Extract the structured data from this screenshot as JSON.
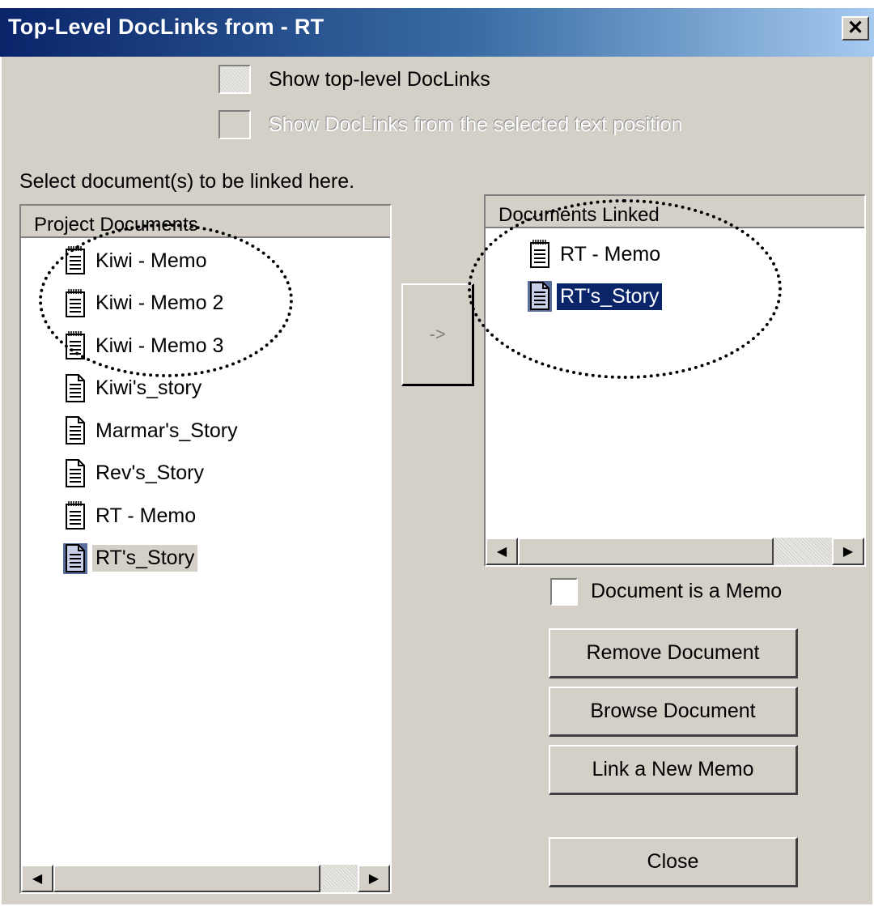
{
  "window": {
    "title": "Top-Level DocLinks from - RT",
    "close_glyph": "✕"
  },
  "options": {
    "show_top_level_label": "Show top-level DocLinks",
    "show_from_position_label": "Show DocLinks from the selected text position"
  },
  "instruction": "Select document(s) to be linked here.",
  "project_documents": {
    "header": "Project Documents",
    "items": [
      {
        "label": "Kiwi - Memo",
        "icon": "memo-icon"
      },
      {
        "label": "Kiwi - Memo 2",
        "icon": "memo-icon"
      },
      {
        "label": "Kiwi - Memo 3",
        "icon": "memo-icon"
      },
      {
        "label": "Kiwi's_story",
        "icon": "document-icon"
      },
      {
        "label": "Marmar's_Story",
        "icon": "document-icon"
      },
      {
        "label": "Rev's_Story",
        "icon": "document-icon"
      },
      {
        "label": "RT - Memo",
        "icon": "memo-icon"
      },
      {
        "label": "RT's_Story",
        "icon": "document-icon",
        "selected": true
      }
    ]
  },
  "add_button_label": "->",
  "documents_linked": {
    "header": "Documents Linked",
    "items": [
      {
        "label": "RT - Memo",
        "icon": "memo-icon"
      },
      {
        "label": "RT's_Story",
        "icon": "document-icon",
        "selected": true
      }
    ]
  },
  "memo_checkbox_label": "Document is a Memo",
  "buttons": {
    "remove": "Remove Document",
    "browse": "Browse Document",
    "link_memo": "Link a New Memo",
    "close": "Close"
  },
  "scroll_glyphs": {
    "left": "◀",
    "right": "▶"
  }
}
